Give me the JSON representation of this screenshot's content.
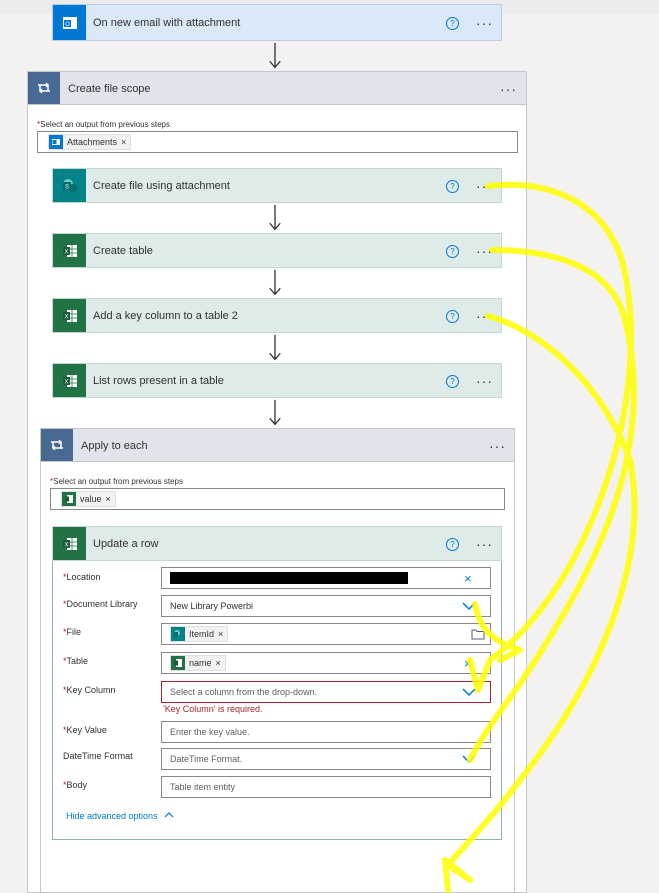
{
  "steps": {
    "trigger": {
      "title": "On new email with attachment"
    },
    "scope": {
      "title": "Create file scope",
      "select_label": "Select an output from previous steps",
      "token": "Attachments"
    },
    "create_file": {
      "title": "Create file using attachment"
    },
    "create_table": {
      "title": "Create table"
    },
    "add_key": {
      "title": "Add a key column to a table 2"
    },
    "list_rows": {
      "title": "List rows present in a table"
    },
    "apply_each": {
      "title": "Apply to each",
      "select_label": "Select an output from previous steps",
      "token": "value"
    },
    "update_row": {
      "title": "Update a row",
      "fields": {
        "location": {
          "label": "Location"
        },
        "doclib": {
          "label": "Document Library",
          "value": "New Library Powerbi"
        },
        "file": {
          "label": "File",
          "token": "ItemId"
        },
        "table": {
          "label": "Table",
          "token": "name"
        },
        "key_column": {
          "label": "Key Column",
          "placeholder": "Select a column from the drop-down.",
          "error": "'Key Column' is required."
        },
        "key_value": {
          "label": "Key Value",
          "placeholder": "Enter the key value."
        },
        "datetime": {
          "label": "DateTime Format",
          "placeholder": "DateTime Format."
        },
        "body": {
          "label": "Body",
          "placeholder": "Table item entity"
        }
      },
      "advanced": "Hide advanced options"
    }
  },
  "icons": {
    "help": "?",
    "more": "···",
    "close": "×",
    "chevron": "chevron-down-icon"
  },
  "colors": {
    "outlook": "#0078d4",
    "excel": "#217346",
    "sharepoint": "#038387",
    "scope": "#486991",
    "annotation": "#ffff00"
  }
}
